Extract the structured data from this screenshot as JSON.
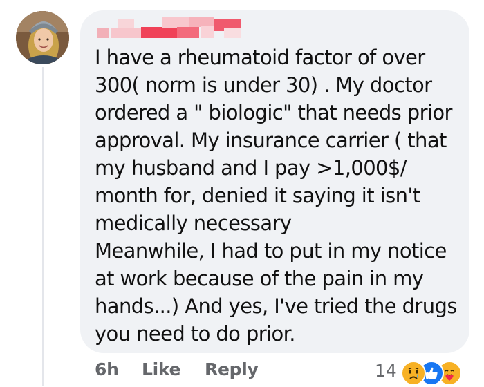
{
  "comment": {
    "author_name": "",
    "text_lines": [
      "I have a rheumatoid factor of over",
      "300( norm is under 30) . My doctor",
      "ordered a \" biologic\" that needs prior",
      "approval.  My insurance carrier ( that",
      "my husband and I pay >1,000$/",
      "month for, denied it saying it isn't",
      "medically necessary",
      "Meanwhile, I had to put in my notice",
      "at work because of the pain in my",
      "hands...) And yes, I've tried the drugs",
      "you need to do prior."
    ]
  },
  "actions": {
    "timestamp": "6h",
    "like_label": "Like",
    "reply_label": "Reply"
  },
  "reactions": {
    "count": "14",
    "icons": [
      "sad-reaction-icon",
      "like-reaction-icon",
      "care-reaction-icon"
    ]
  },
  "colors": {
    "bubble_bg": "#f0f2f5",
    "text": "#111111",
    "meta_text": "#65676b",
    "like_blue": "#1877f2",
    "emoji_yellow": "#f7b125"
  }
}
